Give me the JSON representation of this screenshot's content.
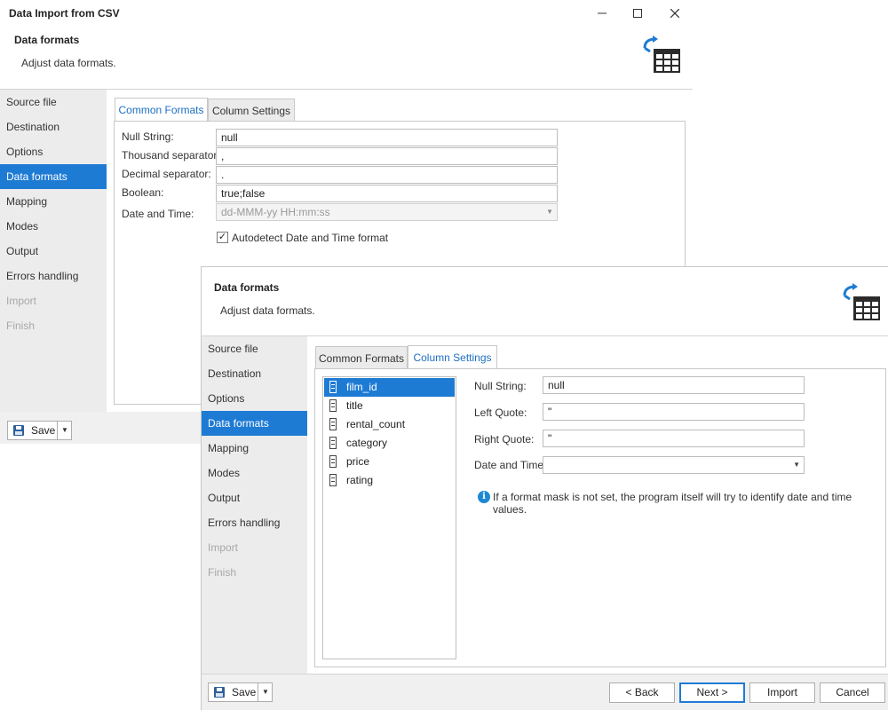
{
  "window": {
    "title": "Data Import from CSV",
    "controls": {
      "minimize": "minimize-icon",
      "maximize": "maximize-icon",
      "close": "close-icon"
    }
  },
  "page_header": {
    "title": "Data formats",
    "subtitle": "Adjust data formats.",
    "icon": "import-table-icon"
  },
  "sidebar": {
    "items": [
      {
        "label": "Source file",
        "state": "normal"
      },
      {
        "label": "Destination",
        "state": "normal"
      },
      {
        "label": "Options",
        "state": "normal"
      },
      {
        "label": "Data formats",
        "state": "active"
      },
      {
        "label": "Mapping",
        "state": "normal"
      },
      {
        "label": "Modes",
        "state": "normal"
      },
      {
        "label": "Output",
        "state": "normal"
      },
      {
        "label": "Errors handling",
        "state": "normal"
      },
      {
        "label": "Import",
        "state": "disabled"
      },
      {
        "label": "Finish",
        "state": "disabled"
      }
    ]
  },
  "tabs": {
    "common": "Common Formats",
    "column": "Column Settings"
  },
  "common_formats": {
    "null_string_label": "Null String:",
    "null_string_value": "null",
    "thousand_sep_label": "Thousand separator:",
    "thousand_sep_value": ",",
    "decimal_sep_label": "Decimal separator:",
    "decimal_sep_value": ".",
    "boolean_label": "Boolean:",
    "boolean_value": "true;false",
    "datetime_label": "Date and Time:",
    "datetime_value": "dd-MMM-yy HH:mm:ss",
    "autodetect_label": "Autodetect Date and Time format",
    "autodetect_checked": true
  },
  "column_settings": {
    "columns": [
      "film_id",
      "title",
      "rental_count",
      "category",
      "price",
      "rating"
    ],
    "selected_index": 0,
    "null_string_label": "Null String:",
    "null_string_value": "null",
    "left_quote_label": "Left Quote:",
    "left_quote_value": "\"",
    "right_quote_label": "Right Quote:",
    "right_quote_value": "\"",
    "datetime_label": "Date and Time:",
    "datetime_value": "",
    "info_text": "If a format mask is not set, the program itself will try to identify date and time values."
  },
  "footer": {
    "save_label": "Save",
    "back_label": "< Back",
    "next_label": "Next >",
    "import_label": "Import",
    "cancel_label": "Cancel"
  },
  "colors": {
    "accent": "#1e7bd4",
    "sidebar_bg": "#ececec",
    "disabled_text": "#a8a8a8",
    "info": "#1e88d6"
  }
}
